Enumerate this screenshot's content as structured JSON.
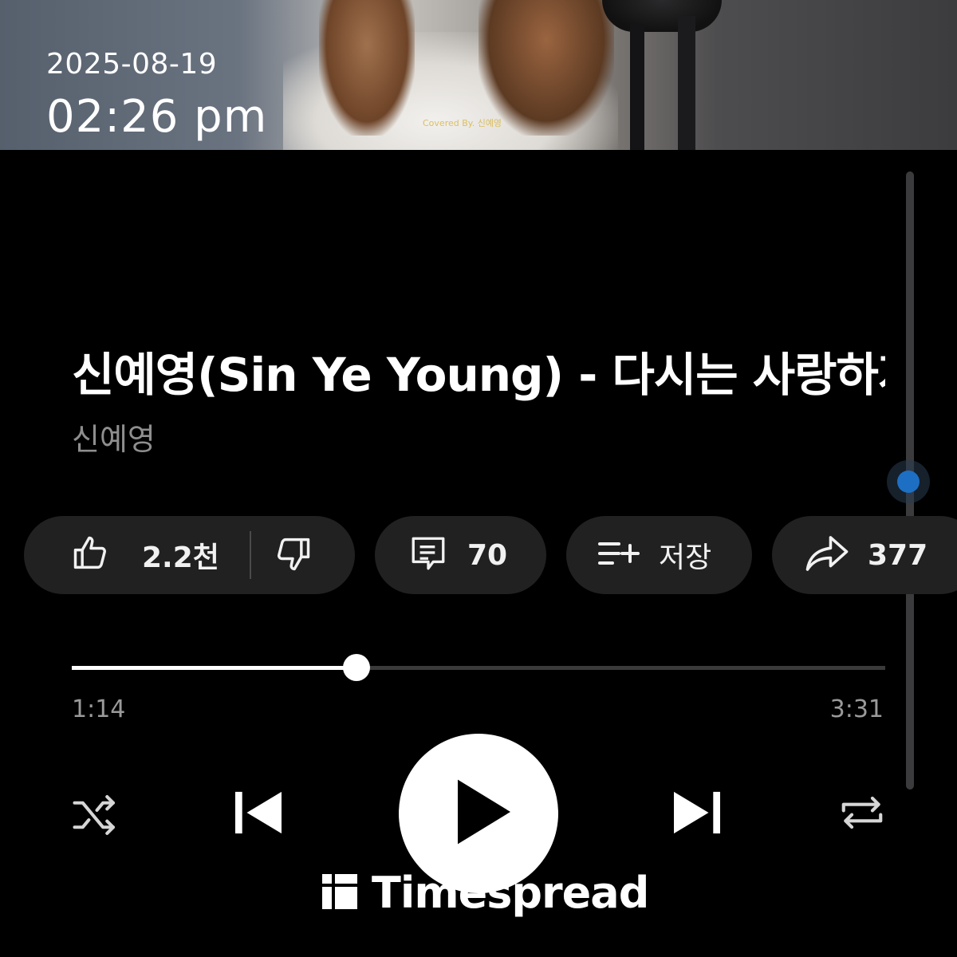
{
  "overlay": {
    "date": "2025-08-19",
    "time": "02:26 pm"
  },
  "thumbnail": {
    "credit_text": "Covered By. 신예영"
  },
  "video": {
    "title": "신예영(Sin Ye Young) - 다시는 사랑하지 않을래",
    "artist": "신예영"
  },
  "actions": {
    "like_count": "2.2천",
    "comment_count": "70",
    "save_label": "저장",
    "share_count": "377"
  },
  "progress": {
    "current_time": "1:14",
    "total_time": "3:31",
    "fraction": 0.35
  },
  "scroll": {
    "position_fraction": 0.47
  },
  "watermark": {
    "text": "Timespread"
  },
  "colors": {
    "background": "#000000",
    "pill": "#212121",
    "accent_blue": "#1d6fc3",
    "text_secondary": "#8e8e8e"
  },
  "icons": {
    "like": "thumbs-up-icon",
    "dislike": "thumbs-down-icon",
    "comment": "comment-icon",
    "save": "playlist-add-icon",
    "share": "share-arrow-icon",
    "shuffle": "shuffle-icon",
    "previous": "skip-previous-icon",
    "play": "play-icon",
    "next": "skip-next-icon",
    "repeat": "repeat-icon"
  }
}
